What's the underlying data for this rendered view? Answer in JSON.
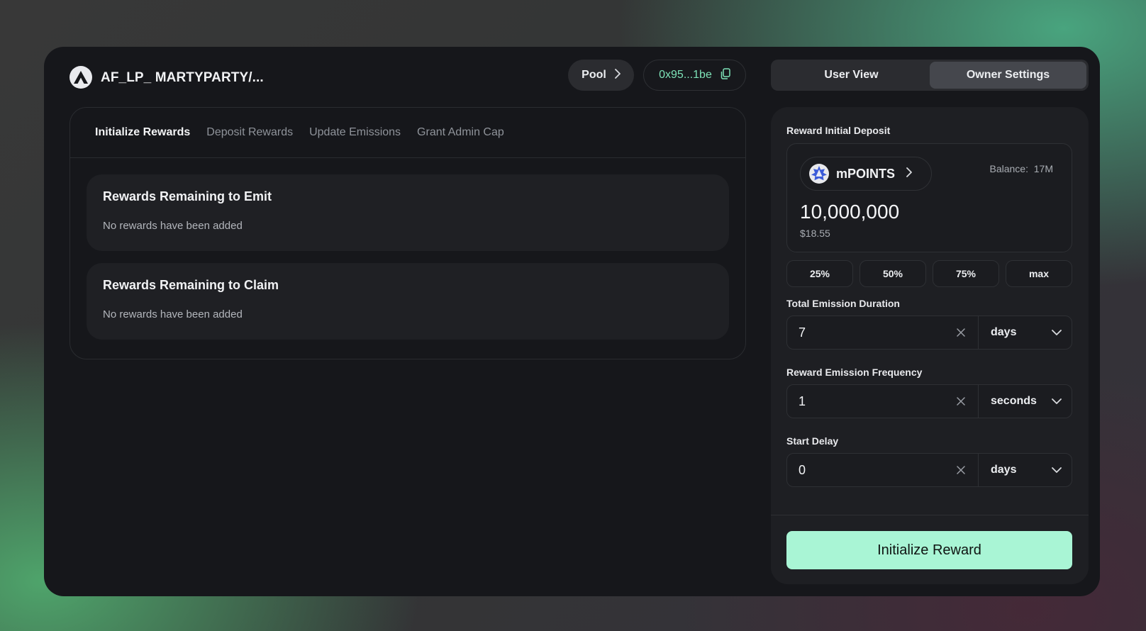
{
  "header": {
    "pool_title": "AF_LP_ MARTYPARTY/...",
    "pool_button": "Pool",
    "address": "0x95...1be"
  },
  "view_toggle": [
    {
      "label": "User View",
      "active": false
    },
    {
      "label": "Owner Settings",
      "active": true
    }
  ],
  "left": {
    "tabs": [
      {
        "label": "Initialize Rewards",
        "active": true
      },
      {
        "label": "Deposit Rewards",
        "active": false
      },
      {
        "label": "Update Emissions",
        "active": false
      },
      {
        "label": "Grant Admin Cap",
        "active": false
      }
    ],
    "cards": [
      {
        "title": "Rewards Remaining to Emit",
        "text": "No rewards have been added"
      },
      {
        "title": "Rewards Remaining to Claim",
        "text": "No rewards have been added"
      }
    ]
  },
  "right": {
    "deposit_label": "Reward Initial Deposit",
    "token": "mPOINTS",
    "balance_label": "Balance:",
    "balance_value": "17M",
    "amount": "10,000,000",
    "usd": "$18.55",
    "percent_buttons": [
      "25%",
      "50%",
      "75%",
      "max"
    ],
    "duration": {
      "label": "Total Emission Duration",
      "value": "7",
      "unit": "days"
    },
    "frequency": {
      "label": "Reward Emission Frequency",
      "value": "1",
      "unit": "seconds"
    },
    "delay": {
      "label": "Start Delay",
      "value": "0",
      "unit": "days"
    },
    "submit": "Initialize Reward"
  },
  "colors": {
    "accent": "#a9f5d5",
    "address_text": "#7ee3b8",
    "window_bg": "#16171b"
  }
}
